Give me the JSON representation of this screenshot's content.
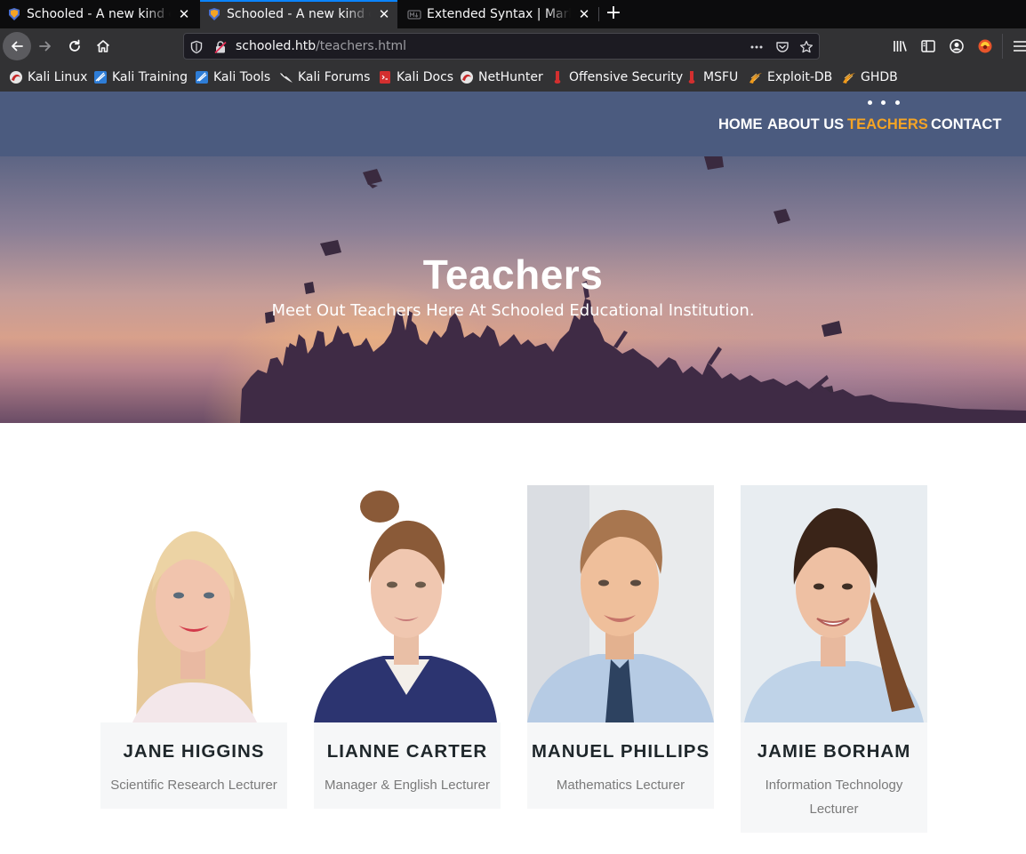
{
  "browser": {
    "tabs": [
      {
        "title": "Schooled - A new kind of educational institute",
        "selected": false
      },
      {
        "title": "Schooled - A new kind of educational institute",
        "selected": true
      },
      {
        "title": "Extended Syntax | Markdown Guide",
        "selected": false
      }
    ],
    "url": {
      "host": "schooled.htb",
      "path": "/teachers.html"
    },
    "bookmarks": [
      {
        "label": "Kali Linux",
        "icon": "kali-dragon-icon"
      },
      {
        "label": "Kali Training",
        "icon": "kali-training-icon"
      },
      {
        "label": "Kali Tools",
        "icon": "kali-tools-icon"
      },
      {
        "label": "Kali Forums",
        "icon": "kali-forums-icon"
      },
      {
        "label": "Kali Docs",
        "icon": "kali-docs-icon"
      },
      {
        "label": "NetHunter",
        "icon": "nethunter-icon"
      },
      {
        "label": "Offensive Security",
        "icon": "offsec-icon"
      },
      {
        "label": "MSFU",
        "icon": "msfu-icon"
      },
      {
        "label": "Exploit-DB",
        "icon": "exploit-db-icon"
      },
      {
        "label": "GHDB",
        "icon": "ghdb-icon"
      }
    ]
  },
  "site": {
    "nav": [
      {
        "label": "HOME",
        "active": false
      },
      {
        "label": "ABOUT US",
        "active": false
      },
      {
        "label": "TEACHERS",
        "active": true
      },
      {
        "label": "CONTACT",
        "active": false
      }
    ],
    "hero": {
      "title": "Teachers",
      "subtitle": "Meet Out Teachers Here At Schooled Educational Institution."
    },
    "teachers": [
      {
        "name": "JANE HIGGINS",
        "role": "Scientific Research Lecturer"
      },
      {
        "name": "LIANNE CARTER",
        "role": "Manager & English Lecturer"
      },
      {
        "name": "MANUEL PHILLIPS",
        "role": "Mathematics Lecturer"
      },
      {
        "name": "JAMIE BORHAM",
        "role": "Information Technology Lecturer"
      }
    ]
  },
  "colors": {
    "site_header": "#4b5b7f",
    "nav_active": "#f5a425",
    "tab_accent": "#0a84ff",
    "card_info_bg": "#f6f7f8"
  }
}
